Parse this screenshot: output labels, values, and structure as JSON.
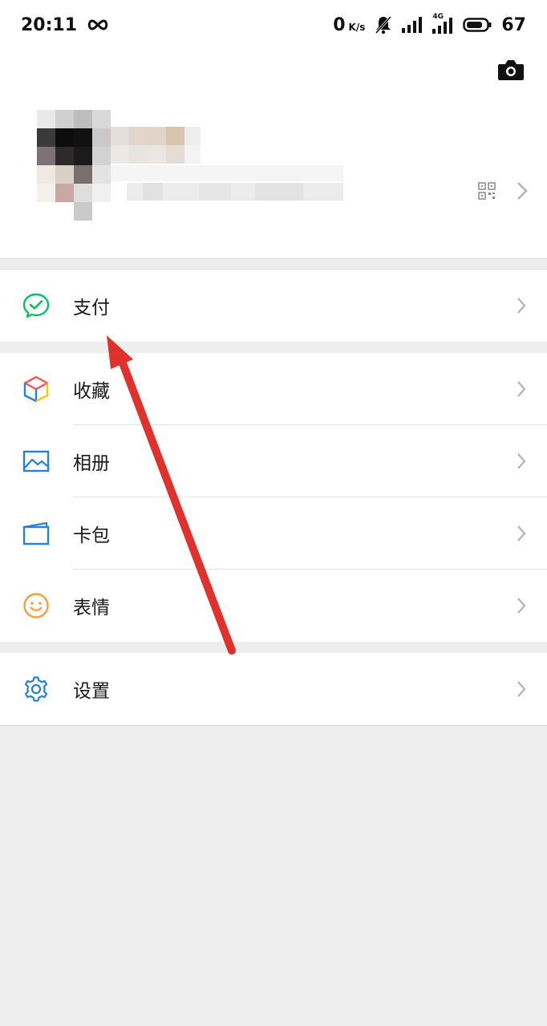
{
  "status_bar": {
    "time": "20:11",
    "speed_value": "0",
    "speed_unit": "K/s",
    "network": "4G",
    "battery": "67"
  },
  "profile": {
    "camera_icon": "camera-icon",
    "qr_icon": "qr-code-icon"
  },
  "menu": {
    "pay": {
      "label": "支付",
      "icon": "wechat-pay-icon",
      "color": "#07c160"
    },
    "favorites": {
      "label": "收藏",
      "icon": "cube-icon"
    },
    "album": {
      "label": "相册",
      "icon": "photo-icon",
      "color": "#2782d7"
    },
    "cards": {
      "label": "卡包",
      "icon": "wallet-icon",
      "color": "#2782d7"
    },
    "stickers": {
      "label": "表情",
      "icon": "smiley-icon",
      "color": "#fa9d3b"
    },
    "settings": {
      "label": "设置",
      "icon": "gear-icon",
      "color": "#2782d7"
    }
  },
  "annotation": {
    "arrow_color": "#e0312c"
  }
}
